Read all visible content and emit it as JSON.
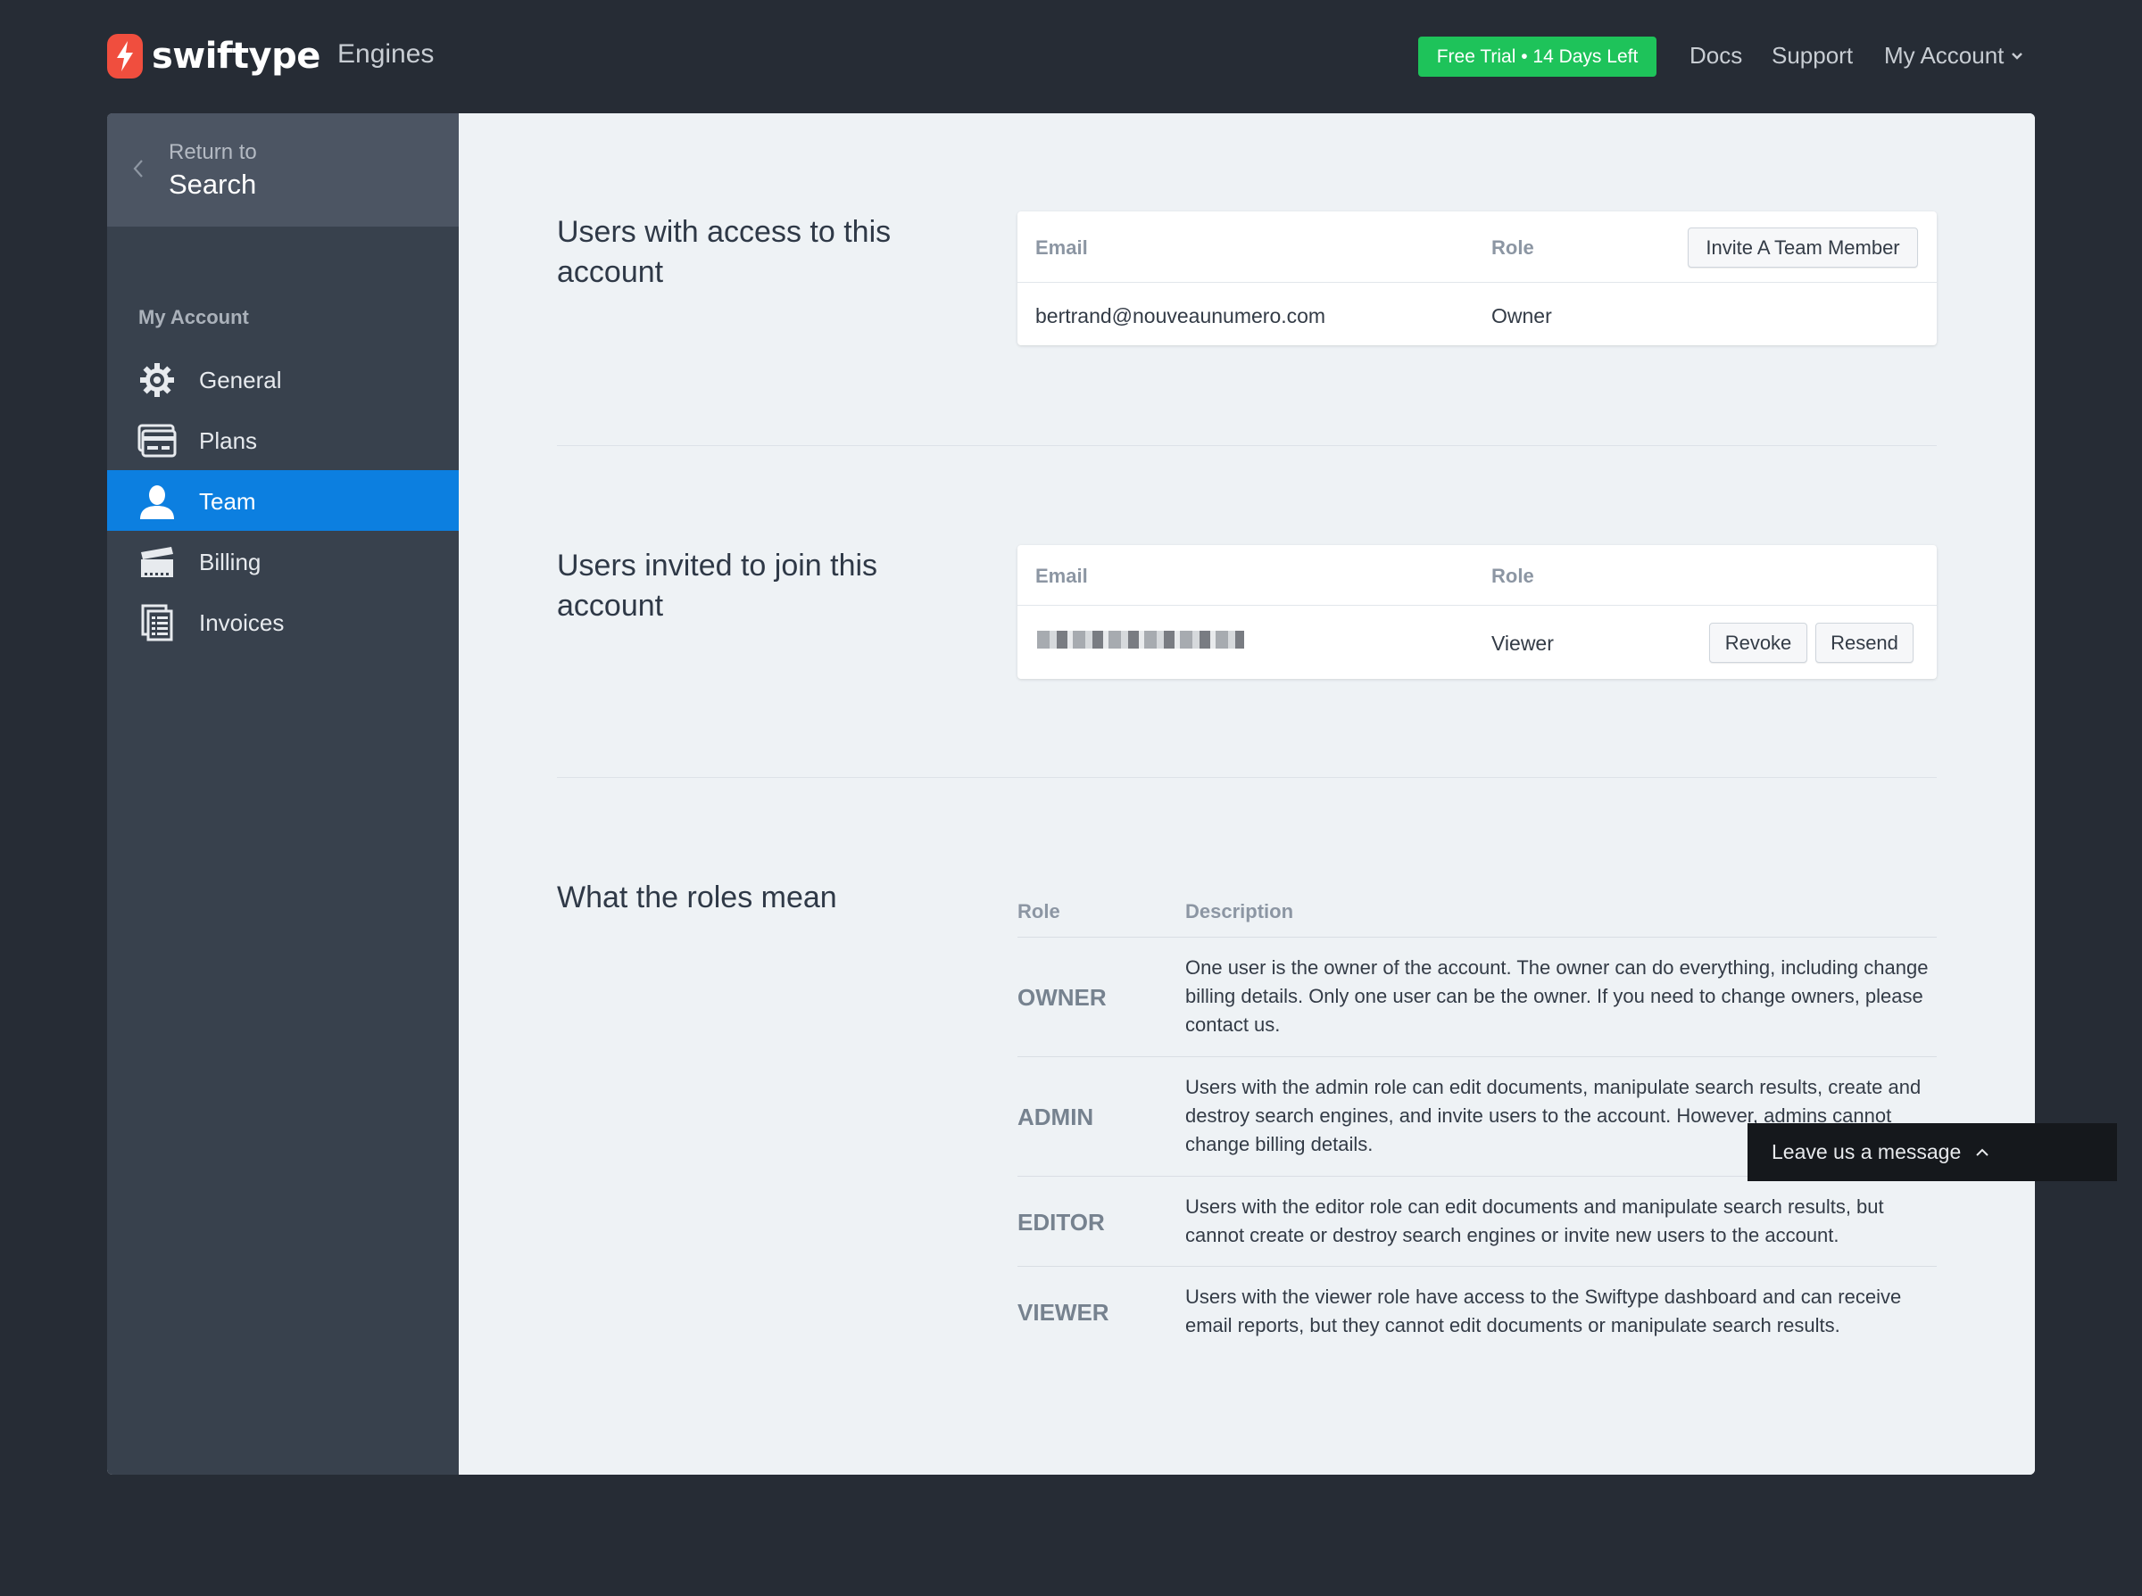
{
  "header": {
    "brand": "swiftype",
    "engines_label": "Engines",
    "trial_badge": "Free Trial • 14 Days Left",
    "nav": {
      "docs": "Docs",
      "support": "Support",
      "account": "My Account"
    }
  },
  "sidebar": {
    "return": {
      "line1": "Return to",
      "line2": "Search"
    },
    "heading": "My Account",
    "items": [
      {
        "label": "General",
        "icon": "gear-icon"
      },
      {
        "label": "Plans",
        "icon": "credit-card-icon"
      },
      {
        "label": "Team",
        "icon": "user-icon",
        "active": true
      },
      {
        "label": "Billing",
        "icon": "billing-icon"
      },
      {
        "label": "Invoices",
        "icon": "invoice-icon"
      }
    ]
  },
  "users_section": {
    "title": "Users with access to this account",
    "columns": {
      "email": "Email",
      "role": "Role"
    },
    "invite_button": "Invite A Team Member",
    "rows": [
      {
        "email": "bertrand@nouveaunumero.com",
        "role": "Owner"
      }
    ]
  },
  "invited_section": {
    "title": "Users invited to join this account",
    "columns": {
      "email": "Email",
      "role": "Role"
    },
    "rows": [
      {
        "role": "Viewer",
        "revoke": "Revoke",
        "resend": "Resend"
      }
    ]
  },
  "roles_section": {
    "title": "What the roles mean",
    "columns": {
      "role": "Role",
      "description": "Description"
    },
    "roles": [
      {
        "name": "OWNER",
        "description": "One user is the owner of the account. The owner can do everything, including change billing details. Only one user can be the owner. If you need to change owners, please contact us."
      },
      {
        "name": "ADMIN",
        "description": "Users with the admin role can edit documents, manipulate search results, create and destroy search engines, and invite users to the account. However, admins cannot change billing details."
      },
      {
        "name": "EDITOR",
        "description": "Users with the editor role can edit documents and manipulate search results, but cannot create or destroy search engines or invite new users to the account."
      },
      {
        "name": "VIEWER",
        "description": "Users with the viewer role have access to the Swiftype dashboard and can receive email reports, but they cannot edit documents or manipulate search results."
      }
    ]
  },
  "chat_widget": {
    "label": "Leave us a message"
  },
  "colors": {
    "accent": "#0c7fe0",
    "trial": "#1ec35a",
    "brand": "#f04e3e"
  }
}
